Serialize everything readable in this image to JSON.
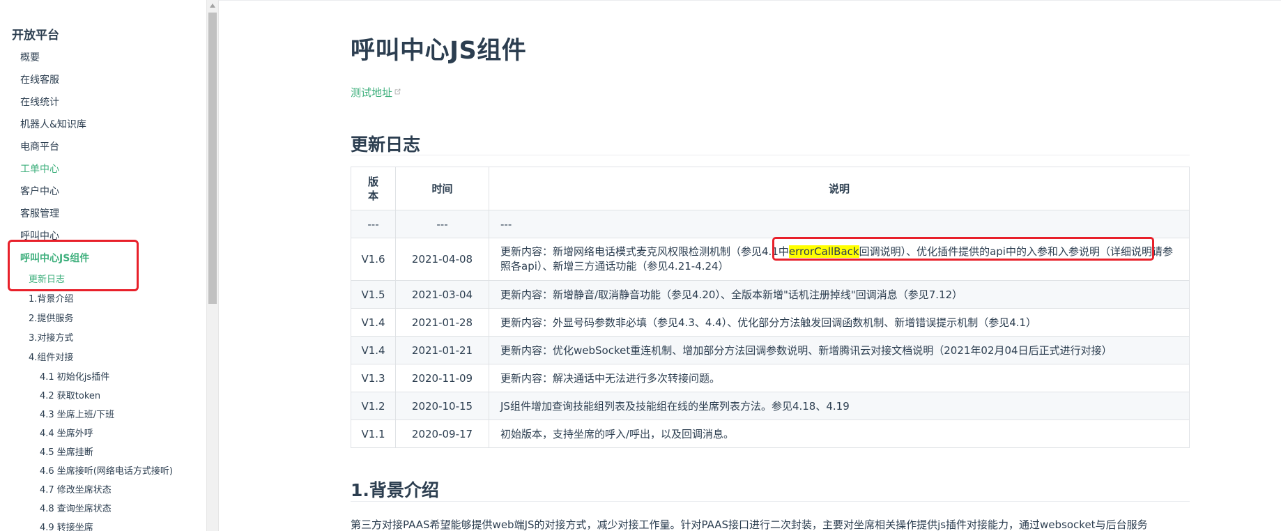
{
  "sidebar": {
    "title": "开放平台",
    "items": [
      {
        "label": "概要"
      },
      {
        "label": "在线客服"
      },
      {
        "label": "在线统计"
      },
      {
        "label": "机器人&知识库"
      },
      {
        "label": "电商平台"
      },
      {
        "label": "工单中心"
      },
      {
        "label": "客户中心"
      },
      {
        "label": "客服管理"
      },
      {
        "label": "呼叫中心"
      },
      {
        "label": "呼叫中心JS组件"
      }
    ],
    "sub_items": [
      {
        "label": "更新日志"
      },
      {
        "label": "1.背景介绍"
      },
      {
        "label": "2.提供服务"
      },
      {
        "label": "3.对接方式"
      },
      {
        "label": "4.组件对接"
      }
    ],
    "sub_sub_items": [
      {
        "label": "4.1 初始化js插件"
      },
      {
        "label": "4.2 获取token"
      },
      {
        "label": "4.3 坐席上班/下班"
      },
      {
        "label": "4.4 坐席外呼"
      },
      {
        "label": "4.5 坐席挂断"
      },
      {
        "label": "4.6 坐席接听(网络电话方式接听)"
      },
      {
        "label": "4.7 修改坐席状态"
      },
      {
        "label": "4.8 查询坐席状态"
      },
      {
        "label": "4.9 转接坐席"
      }
    ]
  },
  "main": {
    "title": "呼叫中心JS组件",
    "test_link": "测试地址",
    "changelog_heading": "更新日志",
    "table": {
      "headers": [
        "版本",
        "时间",
        "说明"
      ],
      "rows": [
        {
          "version": "---",
          "date": "---",
          "desc": "---"
        },
        {
          "version": "V1.6",
          "date": "2021-04-08",
          "desc_a": "更新内容：新增网络电话模式麦克风权限检测机制（参见4.1中",
          "desc_hl": "errorCallBack",
          "desc_b": "回调说明）、优化插件提供的api中的入参和入参说明（详细说明请参照各api）、新增三方通话功能（参见4.21-4.24）"
        },
        {
          "version": "V1.5",
          "date": "2021-03-04",
          "desc": "更新内容：新增静音/取消静音功能（参见4.20）、全版本新增\"话机注册掉线\"回调消息（参见7.12）"
        },
        {
          "version": "V1.4",
          "date": "2021-01-28",
          "desc": "更新内容：外显号码参数非必填（参见4.3、4.4）、优化部分方法触发回调函数机制、新增错误提示机制（参见4.1）"
        },
        {
          "version": "V1.4",
          "date": "2021-01-21",
          "desc": "更新内容：优化webSocket重连机制、增加部分方法回调参数说明、新增腾讯云对接文档说明（2021年02月04日后正式进行对接）"
        },
        {
          "version": "V1.3",
          "date": "2020-11-09",
          "desc": "更新内容：解决通话中无法进行多次转接问题。"
        },
        {
          "version": "V1.2",
          "date": "2020-10-15",
          "desc": "JS组件增加查询技能组列表及技能组在线的坐席列表方法。参见4.18、4.19"
        },
        {
          "version": "V1.1",
          "date": "2020-09-17",
          "desc": "初始版本，支持坐席的呼入/呼出，以及回调消息。"
        }
      ]
    },
    "background_heading": "1.背景介绍",
    "background_text": "第三方对接PAAS希望能够提供web端JS的对接方式，减少对接工作量。针对PAAS接口进行二次封装，主要对坐席相关操作提供js插件对接能力，通过websocket与后台服务"
  },
  "colors": {
    "accent": "#3eaf7c",
    "text": "#2c3e50",
    "highlight_box": "#e8202a",
    "text_highlight": "#ffff00"
  }
}
